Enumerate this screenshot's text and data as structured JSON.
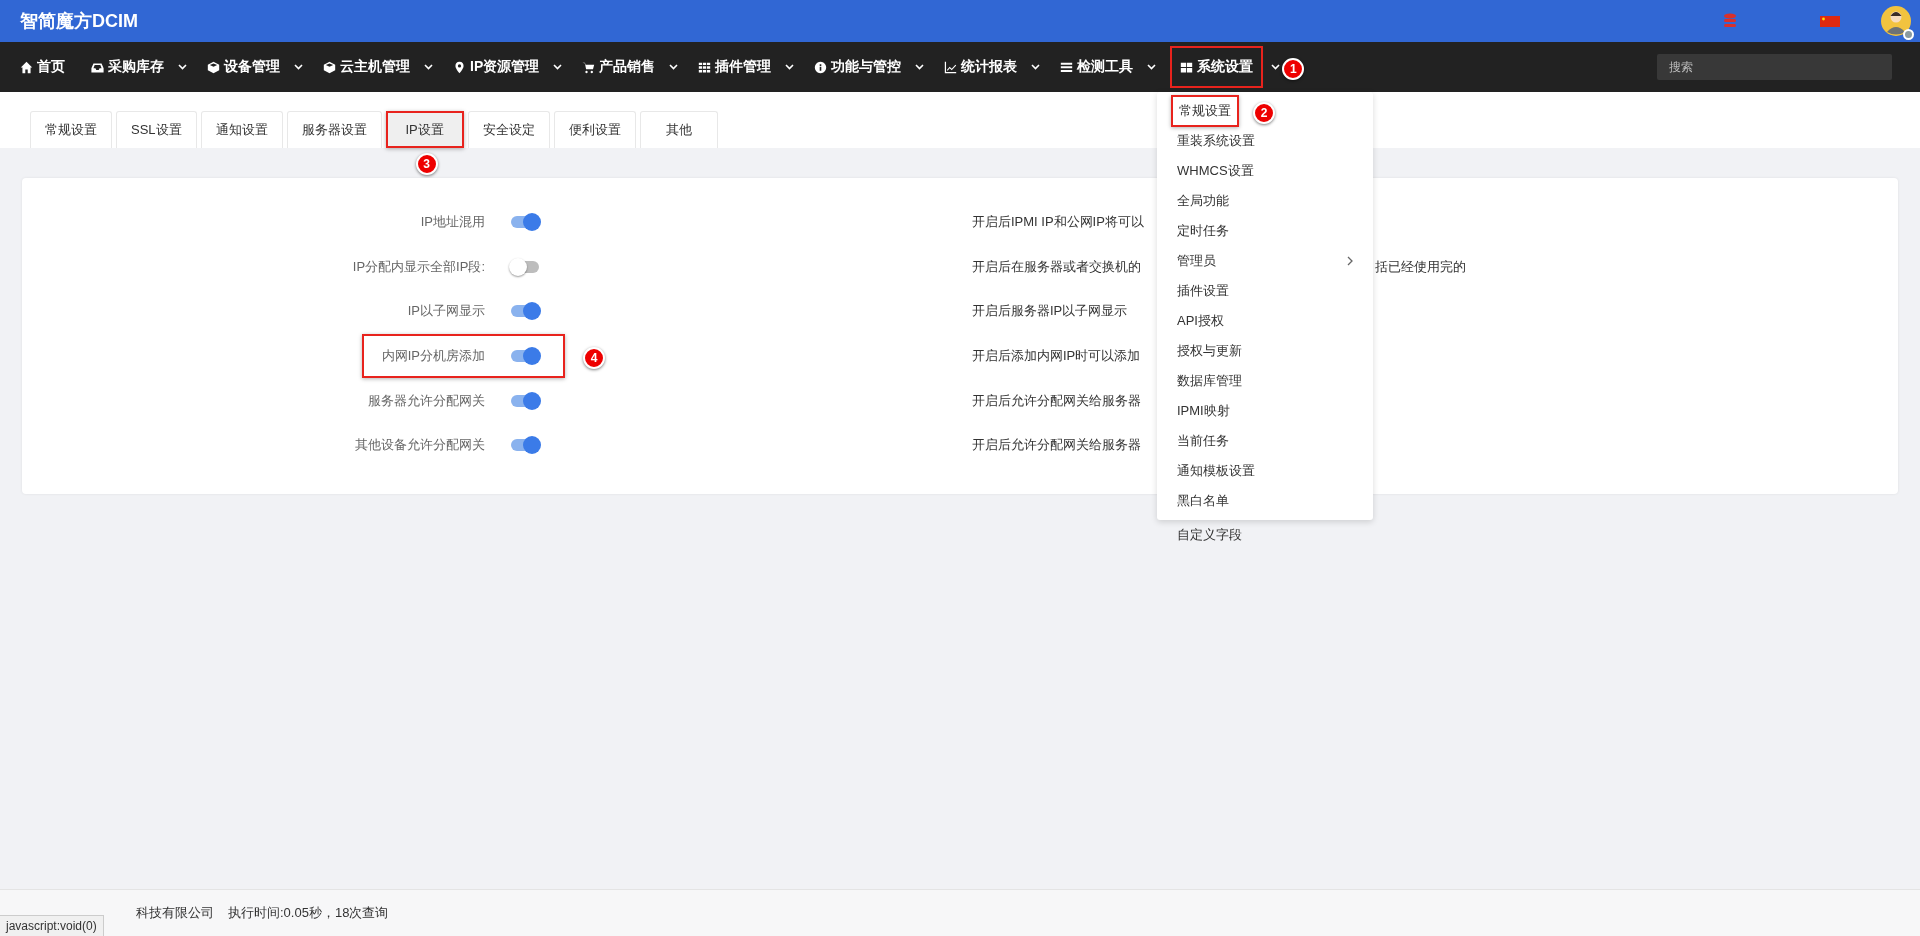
{
  "header": {
    "title": "智简魔方DCIM"
  },
  "nav": {
    "items": [
      {
        "label": "首页",
        "caret": false,
        "highlighted": false
      },
      {
        "label": "采购库存",
        "caret": true,
        "highlighted": false
      },
      {
        "label": "设备管理",
        "caret": true,
        "highlighted": false
      },
      {
        "label": "云主机管理",
        "caret": true,
        "highlighted": false
      },
      {
        "label": "IP资源管理",
        "caret": true,
        "highlighted": false
      },
      {
        "label": "产品销售",
        "caret": true,
        "highlighted": false
      },
      {
        "label": "插件管理",
        "caret": true,
        "highlighted": false
      },
      {
        "label": "功能与管控",
        "caret": true,
        "highlighted": false
      },
      {
        "label": "统计报表",
        "caret": true,
        "highlighted": false
      },
      {
        "label": "检测工具",
        "caret": true,
        "highlighted": false
      },
      {
        "label": "系统设置",
        "caret": true,
        "highlighted": true,
        "callout": "1"
      }
    ],
    "search": {
      "placeholder": "搜索"
    }
  },
  "tabs": [
    {
      "label": "常规设置",
      "selected": false
    },
    {
      "label": "SSL设置",
      "selected": false
    },
    {
      "label": "通知设置",
      "selected": false
    },
    {
      "label": "服务器设置",
      "selected": false
    },
    {
      "label": "IP设置",
      "selected": true,
      "callout": "3"
    },
    {
      "label": "安全设定",
      "selected": false
    },
    {
      "label": "便利设置",
      "selected": false
    },
    {
      "label": "其他",
      "selected": false
    }
  ],
  "settings": [
    {
      "label": "IP地址混用",
      "on": true,
      "highlighted": false,
      "description": "开启后IPMI IP和公网IP将可以"
    },
    {
      "label": "IP分配内显示全部IP段:",
      "on": false,
      "highlighted": false,
      "description": "开启后在服务器或者交换机的",
      "description_tail": "括已经使用完的"
    },
    {
      "label": "IP以子网显示",
      "on": true,
      "highlighted": false,
      "description": "开启后服务器IP以子网显示"
    },
    {
      "label": "内网IP分机房添加",
      "on": true,
      "highlighted": true,
      "callout": "4",
      "description": "开启后添加内网IP时可以添加"
    },
    {
      "label": "服务器允许分配网关",
      "on": true,
      "highlighted": false,
      "description": "开启后允许分配网关给服务器"
    },
    {
      "label": "其他设备允许分配网关",
      "on": true,
      "highlighted": false,
      "description": "开启后允许分配网关给服务器"
    }
  ],
  "dropdown": {
    "items": [
      {
        "label": "常规设置",
        "submenu": false,
        "highlighted": true,
        "callout": "2"
      },
      {
        "label": "重装系统设置",
        "submenu": false,
        "highlighted": false
      },
      {
        "label": "WHMCS设置",
        "submenu": false,
        "highlighted": false
      },
      {
        "label": "全局功能",
        "submenu": false,
        "highlighted": false
      },
      {
        "label": "定时任务",
        "submenu": false,
        "highlighted": false
      },
      {
        "label": "管理员",
        "submenu": true,
        "highlighted": false
      },
      {
        "label": "插件设置",
        "submenu": false,
        "highlighted": false
      },
      {
        "label": "API授权",
        "submenu": false,
        "highlighted": false
      },
      {
        "label": "授权与更新",
        "submenu": false,
        "highlighted": false
      },
      {
        "label": "数据库管理",
        "submenu": false,
        "highlighted": false
      },
      {
        "label": "IPMI映射",
        "submenu": false,
        "highlighted": false
      },
      {
        "label": "当前任务",
        "submenu": false,
        "highlighted": false
      },
      {
        "label": "通知模板设置",
        "submenu": false,
        "highlighted": false
      },
      {
        "label": "黑白名单",
        "submenu": false,
        "highlighted": false
      }
    ],
    "overflow_items": [
      "自定义字段"
    ]
  },
  "footer": {
    "company": "科技有限公司",
    "stats": "执行时间:0.05秒，18次查询"
  },
  "status_tooltip": "javascript:void(0)"
}
